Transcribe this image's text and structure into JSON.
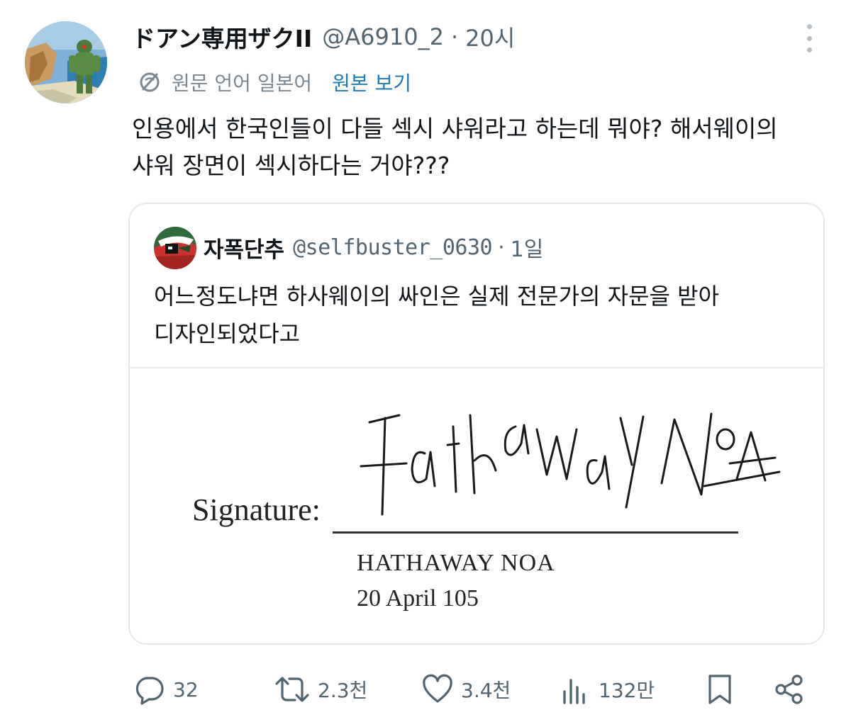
{
  "tweet": {
    "display_name": "ドアン専用ザクII",
    "handle": "@A6910_2",
    "separator": "·",
    "time": "20시",
    "translation_note": "원문 언어 일본어",
    "show_original": "원본 보기",
    "text_lines": [
      "인용에서 한국인들이 다들 섹시 샤워라고 하는데 뭐야? 해서웨이의",
      "샤워 장면이 섹시하다는 거야???"
    ]
  },
  "quote": {
    "display_name": "자폭단추",
    "handle": "@selfbuster_0630",
    "separator": "·",
    "time": "1일",
    "text_lines": [
      "어느정도냐면 하사웨이의 싸인은 실제 전문가의 자문을 받아",
      "디자인되었다고"
    ],
    "media": {
      "signature_label": "Signature:",
      "printed_name": "HATHAWAY NOA",
      "date": "20 April 105",
      "handwritten_signature": "Hathaway Noa"
    }
  },
  "actions": {
    "replies": "32",
    "reposts": "2.3천",
    "likes": "3.4천",
    "views": "132만"
  },
  "icons": {
    "reply": "reply-icon",
    "repost": "repost-icon",
    "like": "heart-icon",
    "views": "views-icon",
    "bookmark": "bookmark-icon",
    "share": "share-icon",
    "more": "more-icon",
    "translate": "translate-icon"
  },
  "colors": {
    "text": "#0f1419",
    "secondary": "#536471",
    "link": "#1d7ab8",
    "border": "#e3e7ea"
  }
}
